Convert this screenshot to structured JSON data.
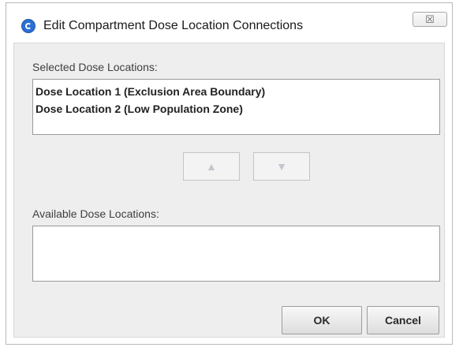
{
  "window": {
    "title": "Edit Compartment Dose Location Connections",
    "close_glyph": "☒"
  },
  "selected": {
    "label": "Selected Dose Locations:",
    "items": [
      "Dose Location 1 (Exclusion Area Boundary)",
      "Dose Location 2 (Low Population Zone)"
    ]
  },
  "move_buttons": {
    "up_glyph": "▲",
    "down_glyph": "▼"
  },
  "available": {
    "label": "Available Dose Locations:",
    "items": []
  },
  "buttons": {
    "ok": "OK",
    "cancel": "Cancel"
  },
  "colors": {
    "accent": "#2b6fd6",
    "dialog_bg": "#eeeeee"
  }
}
